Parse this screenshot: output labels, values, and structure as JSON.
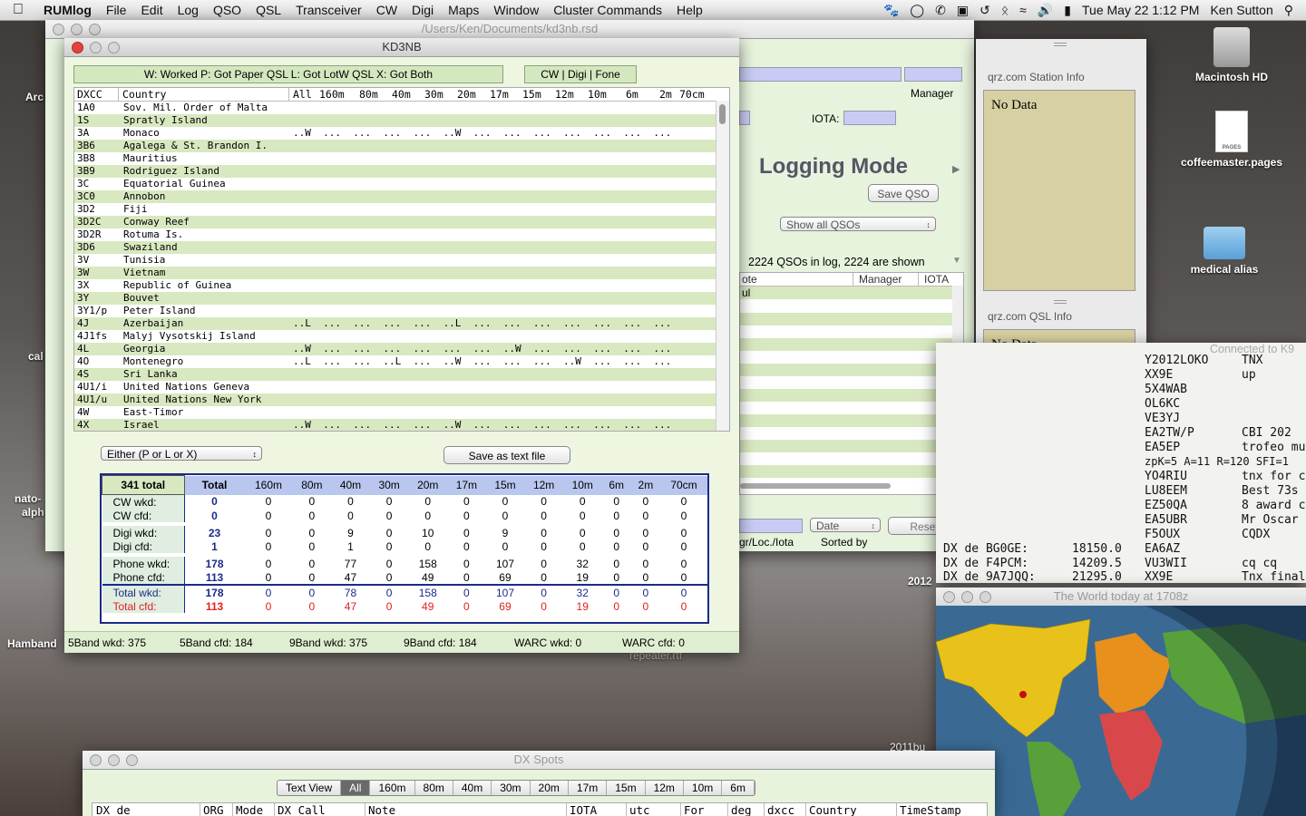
{
  "menubar": {
    "app": "RUMlog",
    "items": [
      "File",
      "Edit",
      "Log",
      "QSO",
      "QSL",
      "Transceiver",
      "CW",
      "Digi",
      "Maps",
      "Window",
      "Cluster Commands",
      "Help"
    ],
    "clock": "Tue May 22  1:12 PM",
    "user": "Ken Sutton"
  },
  "desktop": {
    "macintosh_hd": "Macintosh HD",
    "coffeemaster": "coffeemaster.pages",
    "pages_badge": "PAGES",
    "medical_alias": "medical alias",
    "left_labels": [
      "Arc",
      "cal",
      "nato-",
      "alph",
      "Hamband"
    ],
    "date_2012": "2012",
    "date_2011": "2011bu",
    "repeater": "repeater.rtf"
  },
  "logwin": {
    "path": "/Users/Ken/Documents/kd3nb.rsd",
    "manager_label": "Manager",
    "iota_label": "IOTA:",
    "logging_mode": "Logging Mode",
    "save_qso": "Save QSO",
    "show_all": "Show all QSOs",
    "qso_count": "2224 QSOs in log, 2224 are shown",
    "col_note": "ote",
    "col_manager": "Manager",
    "col_iota": "IOTA",
    "first_row": "ul",
    "sort_popup": "Date",
    "reset": "Reset",
    "gr_loc": "gr/Loc./Iota",
    "sorted_by": "Sorted by"
  },
  "kd3nb": {
    "title": "KD3NB",
    "legend": "W: Worked    P: Got Paper QSL    L: Got LotW QSL    X: Got Both",
    "mode": "CW | Digi | Fone",
    "columns": [
      "DXCC",
      "Country",
      "All",
      "160m",
      "80m",
      "40m",
      "30m",
      "20m",
      "17m",
      "15m",
      "12m",
      "10m",
      "6m",
      "2m",
      "70cm"
    ],
    "rows": [
      {
        "code": "1A0",
        "country": "Sov. Mil. Order of Malta",
        "marks": ""
      },
      {
        "code": "1S",
        "country": "Spratly Island",
        "marks": ""
      },
      {
        "code": "3A",
        "country": "Monaco",
        "marks": "..W  ...  ...  ...  ...  ..W  ...  ...  ...  ...  ...  ...  ..."
      },
      {
        "code": "3B6",
        "country": "Agalega & St. Brandon I.",
        "marks": ""
      },
      {
        "code": "3B8",
        "country": "Mauritius",
        "marks": ""
      },
      {
        "code": "3B9",
        "country": "Rodriguez Island",
        "marks": ""
      },
      {
        "code": "3C",
        "country": "Equatorial Guinea",
        "marks": ""
      },
      {
        "code": "3C0",
        "country": "Annobon",
        "marks": ""
      },
      {
        "code": "3D2",
        "country": "Fiji",
        "marks": ""
      },
      {
        "code": "3D2C",
        "country": "Conway Reef",
        "marks": ""
      },
      {
        "code": "3D2R",
        "country": "Rotuma Is.",
        "marks": ""
      },
      {
        "code": "3D6",
        "country": "Swaziland",
        "marks": ""
      },
      {
        "code": "3V",
        "country": "Tunisia",
        "marks": ""
      },
      {
        "code": "3W",
        "country": "Vietnam",
        "marks": ""
      },
      {
        "code": "3X",
        "country": "Republic of Guinea",
        "marks": ""
      },
      {
        "code": "3Y",
        "country": "Bouvet",
        "marks": ""
      },
      {
        "code": "3Y1/p",
        "country": "Peter Island",
        "marks": ""
      },
      {
        "code": "4J",
        "country": "Azerbaijan",
        "marks": "..L  ...  ...  ...  ...  ..L  ...  ...  ...  ...  ...  ...  ..."
      },
      {
        "code": "4J1fs",
        "country": "Malyj Vysotskij Island",
        "marks": ""
      },
      {
        "code": "4L",
        "country": "Georgia",
        "marks": "..W  ...  ...  ...  ...  ...  ...  ..W  ...  ...  ...  ...  ..."
      },
      {
        "code": "4O",
        "country": "Montenegro",
        "marks": "..L  ...  ...  ..L  ...  ..W  ...  ...  ...  ..W  ...  ...  ..."
      },
      {
        "code": "4S",
        "country": "Sri Lanka",
        "marks": ""
      },
      {
        "code": "4U1/i",
        "country": "United Nations Geneva",
        "marks": ""
      },
      {
        "code": "4U1/u",
        "country": "United Nations New York",
        "marks": ""
      },
      {
        "code": "4W",
        "country": "East-Timor",
        "marks": ""
      },
      {
        "code": "4X",
        "country": "Israel",
        "marks": "..W  ...  ...  ...  ...  ..W  ...  ...  ...  ...  ...  ...  ..."
      }
    ],
    "filter": "Either (P or L or X)",
    "save_text": "Save as text file",
    "totals": {
      "label": "341 total",
      "bands": [
        "Total",
        "160m",
        "80m",
        "40m",
        "30m",
        "20m",
        "17m",
        "15m",
        "12m",
        "10m",
        "6m",
        "2m",
        "70cm"
      ],
      "rows": [
        {
          "name": "CW wkd:",
          "vals": [
            0,
            0,
            0,
            0,
            0,
            0,
            0,
            0,
            0,
            0,
            0,
            0,
            0
          ]
        },
        {
          "name": "CW cfd:",
          "vals": [
            0,
            0,
            0,
            0,
            0,
            0,
            0,
            0,
            0,
            0,
            0,
            0,
            0
          ]
        },
        {
          "name": "Digi wkd:",
          "vals": [
            23,
            0,
            0,
            9,
            0,
            10,
            0,
            9,
            0,
            0,
            0,
            0,
            0
          ]
        },
        {
          "name": "Digi cfd:",
          "vals": [
            1,
            0,
            0,
            1,
            0,
            0,
            0,
            0,
            0,
            0,
            0,
            0,
            0
          ]
        },
        {
          "name": "Phone wkd:",
          "vals": [
            178,
            0,
            0,
            77,
            0,
            158,
            0,
            107,
            0,
            32,
            0,
            0,
            0
          ]
        },
        {
          "name": "Phone cfd:",
          "vals": [
            113,
            0,
            0,
            47,
            0,
            49,
            0,
            69,
            0,
            19,
            0,
            0,
            0
          ]
        },
        {
          "name": "Total wkd:",
          "vals": [
            178,
            0,
            0,
            78,
            0,
            158,
            0,
            107,
            0,
            32,
            0,
            0,
            0
          ]
        },
        {
          "name": "Total cfd:",
          "vals": [
            113,
            0,
            0,
            47,
            0,
            49,
            0,
            69,
            0,
            19,
            0,
            0,
            0
          ]
        }
      ]
    },
    "footer": {
      "band5_wkd": "5Band wkd:   375",
      "band5_cfd": "5Band cfd:   184",
      "band9_wkd": "9Band wkd:  375",
      "band9_cfd": "9Band cfd:   184",
      "warc_wkd": "WARC wkd:   0",
      "warc_cfd": "WARC cfd:   0"
    }
  },
  "qrz": {
    "station_title": "qrz.com Station Info",
    "station_text": "No Data",
    "qsl_title": "qrz.com QSL Info",
    "qsl_text": "No Data"
  },
  "cluster": {
    "connected": "Connected to  K9",
    "spots": [
      {
        "call": "Y2012LOKO",
        "note": "TNX"
      },
      {
        "call": "XX9E",
        "note": "up"
      },
      {
        "call": "5X4WAB",
        "note": ""
      },
      {
        "call": "OL6KC",
        "note": ""
      },
      {
        "call": "VE3YJ",
        "note": ""
      },
      {
        "call": "EA2TW/P",
        "note": "CBI 202"
      },
      {
        "call": "EA5EP",
        "note": "trofeo mu"
      },
      {
        "call": "zpK=5 A=11 R=120 SFI=1",
        "note": ""
      },
      {
        "call": "YO4RIU",
        "note": "tnx for c"
      },
      {
        "call": "LU8EEM",
        "note": "Best 73s"
      },
      {
        "call": "EZ50QA",
        "note": "8 award c"
      },
      {
        "call": "EA5UBR",
        "note": "Mr Oscar"
      },
      {
        "call": "F5OUX",
        "note": "CQDX"
      }
    ],
    "dx_lines": [
      {
        "de": "DX de BG0GE:",
        "freq": "18150.0",
        "call": "EA6AZ",
        "note": ""
      },
      {
        "de": "DX de F4PCM:",
        "freq": "14209.5",
        "call": "VU3WII",
        "note": "cq cq"
      },
      {
        "de": "DX de 9A7JQQ:",
        "freq": "21295.0",
        "call": "XX9E",
        "note": "Tnx final"
      }
    ]
  },
  "worldmap": {
    "title": "The World today at 1708z"
  },
  "dxspots": {
    "title": "DX Spots",
    "tabs": [
      "Text View",
      "All",
      "160m",
      "80m",
      "40m",
      "30m",
      "20m",
      "17m",
      "15m",
      "12m",
      "10m",
      "6m"
    ],
    "selected": "All",
    "columns": [
      "DX de",
      "ORG",
      "Mode",
      "DX Call",
      "Note",
      "IOTA",
      "utc",
      "For",
      "deg",
      "dxcc",
      "Country",
      "TimeStamp"
    ]
  }
}
